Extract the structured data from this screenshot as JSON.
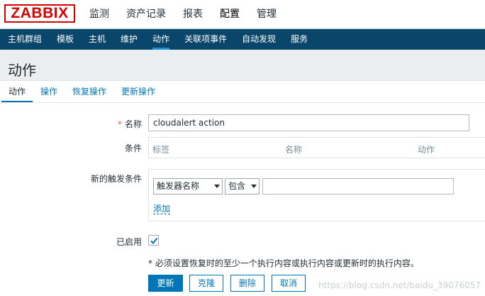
{
  "header": {
    "logo": "ZABBIX",
    "menu": [
      "监测",
      "资产记录",
      "报表",
      "配置",
      "管理"
    ],
    "active_menu": "配置"
  },
  "submenu": {
    "items": [
      "主机群组",
      "模板",
      "主机",
      "维护",
      "动作",
      "关联项事件",
      "自动发现",
      "服务"
    ],
    "active": "动作"
  },
  "page": {
    "title": "动作"
  },
  "tabs": [
    "动作",
    "操作",
    "恢复操作",
    "更新操作"
  ],
  "form": {
    "name_label": "名称",
    "name_value": "cloudalert action",
    "required_mark": "*",
    "conditions_label": "条件",
    "conditions_columns": [
      "标签",
      "名称",
      "动作"
    ],
    "new_condition_label": "新的触发条件",
    "condition_type": "触发器名称",
    "condition_operator": "包含",
    "condition_value": "",
    "add_label": "添加",
    "enabled_label": "已启用",
    "enabled": true,
    "note": "* 必须设置恢复时的至少一个执行内容或执行内容或更新时的执行内容。"
  },
  "buttons": {
    "update": "更新",
    "clone": "克隆",
    "delete": "删除",
    "cancel": "取消"
  },
  "watermark": "https://blog.csdn.net/baidu_39076057",
  "colors": {
    "brand": "#d40000",
    "nav": "#0a466a",
    "accent": "#0275b8"
  }
}
